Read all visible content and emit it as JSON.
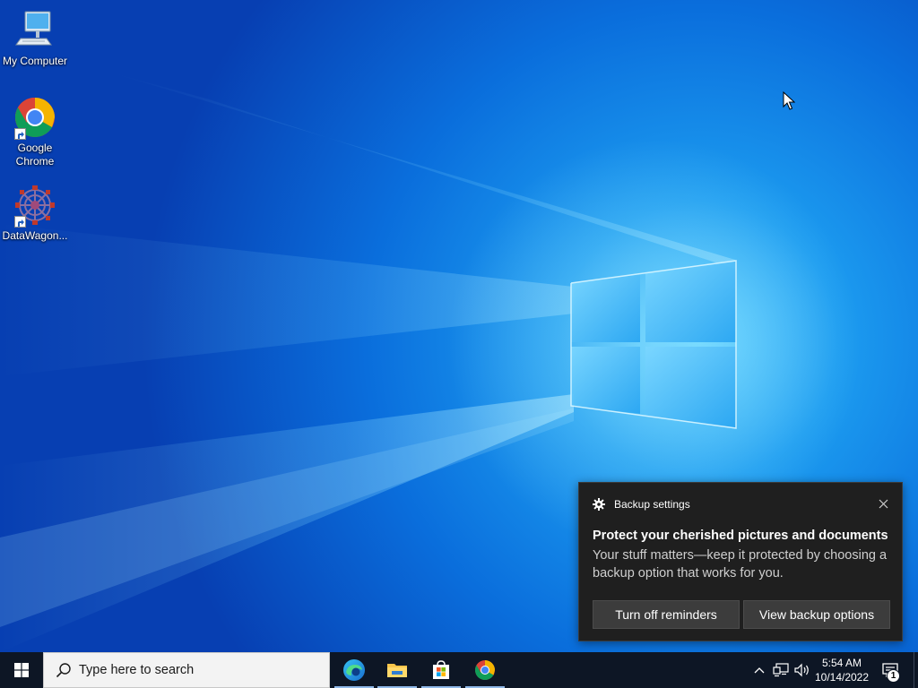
{
  "desktop": {
    "icons": [
      {
        "label": "My Computer",
        "icon": "computer-icon"
      },
      {
        "label": "Google Chrome",
        "icon": "chrome-icon"
      },
      {
        "label": "DataWagon...",
        "icon": "datawagon-icon"
      }
    ]
  },
  "toast": {
    "app_name": "Backup settings",
    "title": "Protect your cherished pictures and documents",
    "body": "Your stuff matters—keep it protected by choosing a backup option that works for you.",
    "buttons": [
      "Turn off reminders",
      "View backup options"
    ]
  },
  "taskbar": {
    "search_placeholder": "Type here to search",
    "pinned": [
      "edge-icon",
      "file-explorer-icon",
      "store-icon",
      "chrome-icon"
    ],
    "clock": {
      "time": "5:54 AM",
      "date": "10/14/2022"
    },
    "notifications": {
      "count": "1"
    }
  },
  "colors": {
    "wallpaper_blue": "#0b63d6",
    "taskbar": "#0d1625",
    "toast_bg": "#1f1f1f"
  }
}
